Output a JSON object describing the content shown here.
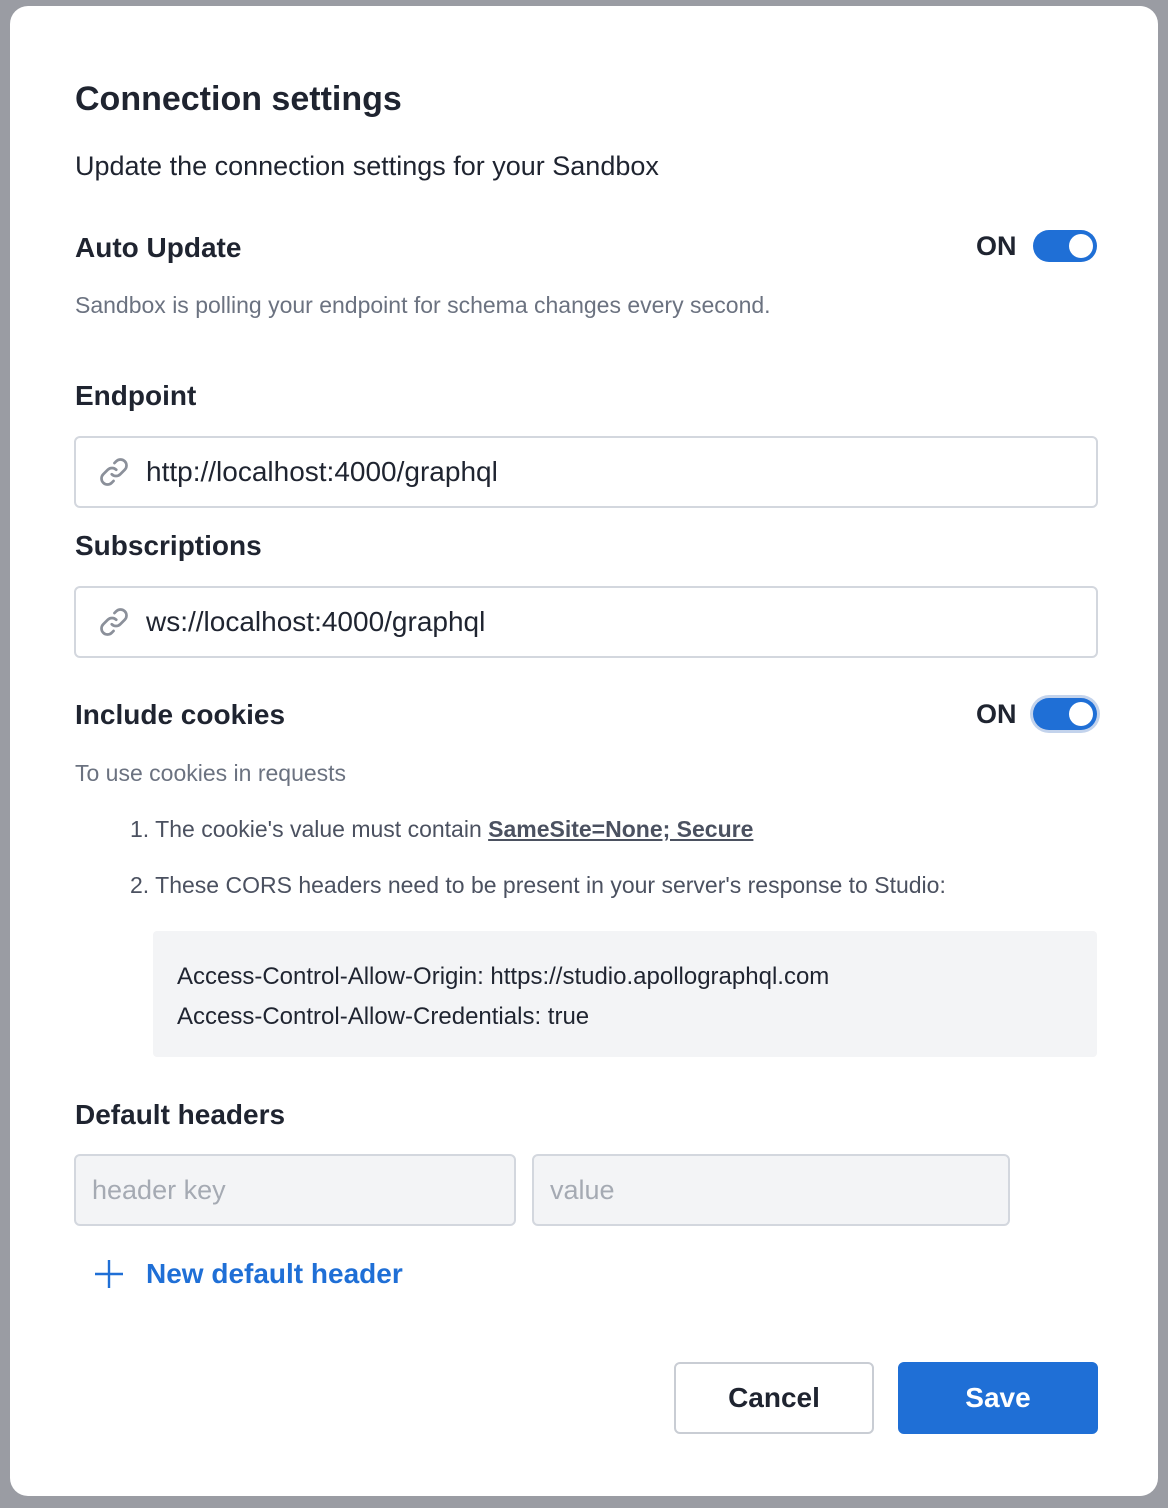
{
  "modal": {
    "title": "Connection settings",
    "subtitle": "Update the connection settings for your Sandbox"
  },
  "auto_update": {
    "label": "Auto Update",
    "state": "ON",
    "enabled": true,
    "description": "Sandbox is polling your endpoint for schema changes every second."
  },
  "endpoint": {
    "label": "Endpoint",
    "value": "http://localhost:4000/graphql",
    "icon": "link-icon"
  },
  "subscriptions": {
    "label": "Subscriptions",
    "value": "ws://localhost:4000/graphql",
    "icon": "link-icon"
  },
  "include_cookies": {
    "label": "Include cookies",
    "state": "ON",
    "enabled": true,
    "intro": "To use cookies in requests",
    "steps": [
      {
        "number": "1.",
        "text": "The cookie's value must contain ",
        "link": "SameSite=None; Secure"
      },
      {
        "number": "2.",
        "text": "These CORS headers need to be present in your server's response to Studio:"
      }
    ],
    "code_lines": [
      "Access-Control-Allow-Origin: https://studio.apollographql.com",
      "Access-Control-Allow-Credentials: true"
    ]
  },
  "default_headers": {
    "label": "Default headers",
    "key_placeholder": "header key",
    "value_placeholder": "value",
    "add_label": "New default header"
  },
  "actions": {
    "cancel_label": "Cancel",
    "save_label": "Save"
  },
  "colors": {
    "accent": "#1f6fd6",
    "toggle_on": "#1f6fd6",
    "muted_text": "#6b7280",
    "code_bg": "#f3f4f6",
    "overlay": "#9a9ca3"
  }
}
